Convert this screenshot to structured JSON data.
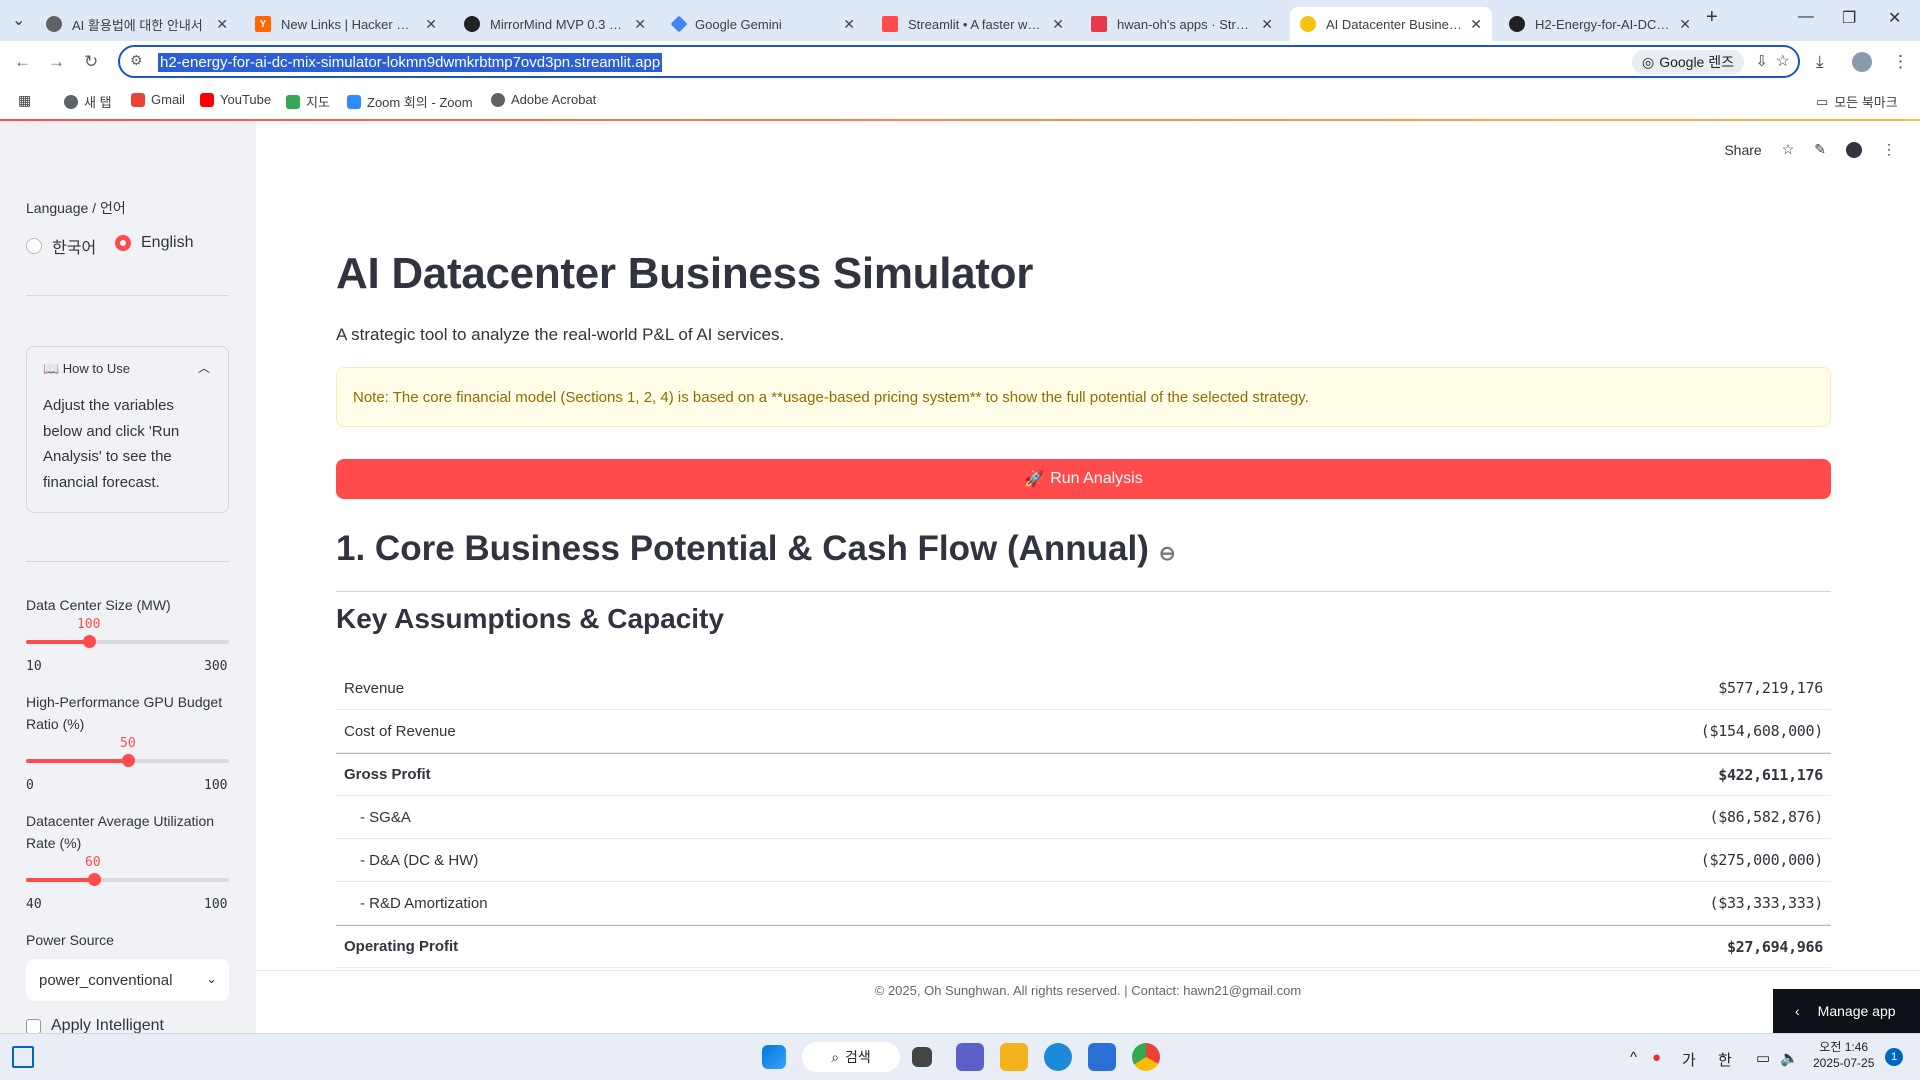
{
  "browser": {
    "tabs": [
      {
        "title": "AI 활용법에 대한 안내서",
        "favicon_color": "#5f6368"
      },
      {
        "title": "New Links | Hacker News",
        "favicon_color": "#ff6600"
      },
      {
        "title": "MirrorMind MVP 0.3 · Str",
        "favicon_color": "#202124"
      },
      {
        "title": "Google Gemini",
        "favicon_color": "#4285f4"
      },
      {
        "title": "Streamlit • A faster way t",
        "favicon_color": "#ff4b4b"
      },
      {
        "title": "hwan-oh's apps · Stream",
        "favicon_color": "#e8394a"
      },
      {
        "title": "AI Datacenter Business S",
        "favicon_color": "#f4c20d"
      },
      {
        "title": "H2-Energy-for-AI-DC-Mi",
        "favicon_color": "#202124"
      }
    ],
    "url": "h2-energy-for-ai-dc-mix-simulator-lokmn9dwmkrbtmp7ovd3pn.streamlit.app",
    "lens_label": "Google 렌즈",
    "bookmarks": [
      "새 탭",
      "Gmail",
      "YouTube",
      "지도",
      "Zoom 회의 - Zoom",
      "Adobe Acrobat"
    ],
    "all_bookmarks": "모든 북마크"
  },
  "sidebar": {
    "language_label": "Language / 언어",
    "language_options": [
      "한국어",
      "English"
    ],
    "language_selected": "English",
    "howto_title": "📖 How to Use",
    "howto_body": "Adjust the variables below and click 'Run Analysis' to see the financial forecast.",
    "sliders": [
      {
        "label": "Data Center Size (MW)",
        "value": "100",
        "min": "10",
        "max": "300",
        "fraction": 0.31
      },
      {
        "label": "High-Performance GPU Budget Ratio (%)",
        "value": "50",
        "min": "0",
        "max": "100",
        "fraction": 0.5
      },
      {
        "label": "Datacenter Average Utilization Rate (%)",
        "value": "60",
        "min": "40",
        "max": "100",
        "fraction": 0.333
      }
    ],
    "power_label": "Power Source",
    "power_value": "power_conventional",
    "checkbox_label": "Apply Intelligent"
  },
  "main": {
    "share": "Share",
    "title": "AI Datacenter Business Simulator",
    "subtitle": "A strategic tool to analyze the real-world P&L of AI services.",
    "note": "Note: The core financial model (Sections 1, 2, 4) is based on a **usage-based pricing system** to show the full potential of the selected strategy.",
    "run_button": "Run Analysis",
    "section1": "1. Core Business Potential & Cash Flow (Annual)",
    "subsection": "Key Assumptions & Capacity",
    "pl_rows": [
      {
        "label": "Revenue",
        "value": "$577,219,176",
        "style": "normal"
      },
      {
        "label": "Cost of Revenue",
        "value": "($154,608,000)",
        "style": "normal"
      },
      {
        "label": "Gross Profit",
        "value": "$422,611,176",
        "style": "bold"
      },
      {
        "label": "- SG&A",
        "value": "($86,582,876)",
        "style": "indent"
      },
      {
        "label": "- D&A (DC & HW)",
        "value": "($275,000,000)",
        "style": "indent"
      },
      {
        "label": "- R&D Amortization",
        "value": "($33,333,333)",
        "style": "indent"
      },
      {
        "label": "Operating Profit",
        "value": "$27,694,966",
        "style": "bold"
      }
    ],
    "footer": "© 2025, Oh Sunghwan. All rights reserved. | Contact: hawn21@gmail.com",
    "manage_app": "Manage app"
  },
  "taskbar": {
    "search": "검색",
    "ime1": "가",
    "ime2": "한",
    "time": "오전 1:46",
    "date": "2025-07-25",
    "notifications": "1"
  }
}
